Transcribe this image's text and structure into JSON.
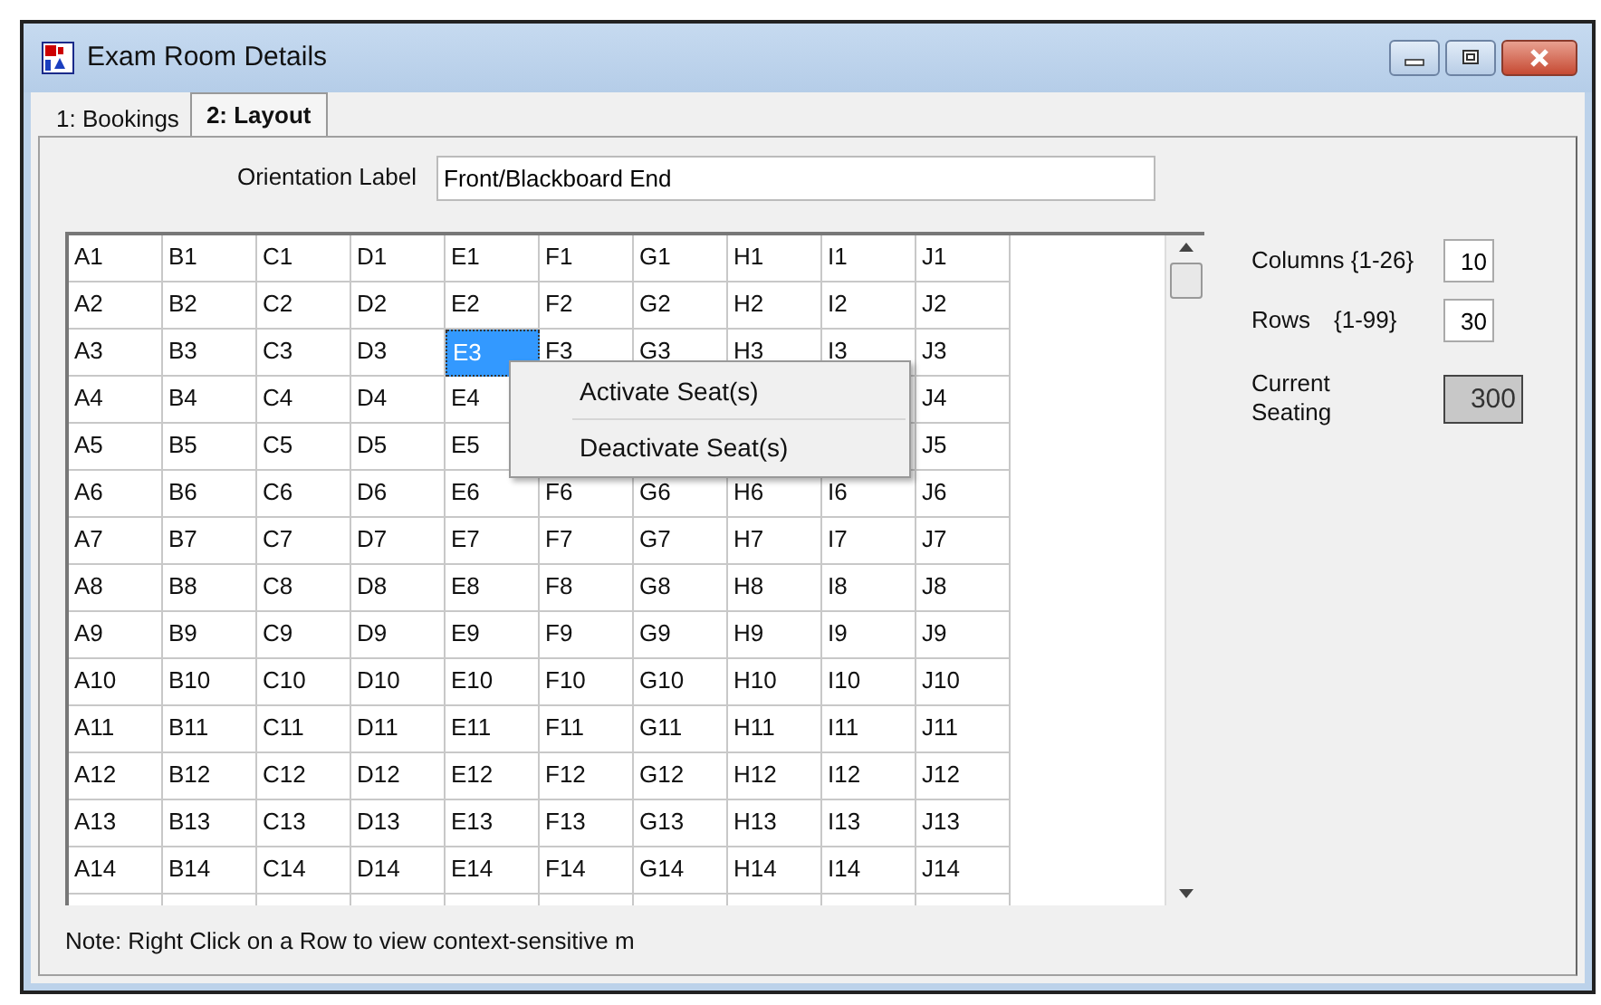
{
  "window": {
    "title": "Exam Room Details"
  },
  "tabs": [
    {
      "label": "1: Bookings",
      "selected": false
    },
    {
      "label": "2: Layout",
      "selected": true
    }
  ],
  "orientation": {
    "label": "Orientation Label",
    "value": "Front/Blackboard End"
  },
  "grid": {
    "rows": [
      [
        {
          "text": "A1",
          "selected": false
        },
        {
          "text": "B1",
          "selected": false
        },
        {
          "text": "C1",
          "selected": false
        },
        {
          "text": "D1",
          "selected": false
        },
        {
          "text": "E1",
          "selected": false
        },
        {
          "text": "F1",
          "selected": false
        },
        {
          "text": "G1",
          "selected": false
        },
        {
          "text": "H1",
          "selected": false
        },
        {
          "text": "I1",
          "selected": false
        },
        {
          "text": "J1",
          "selected": false
        }
      ],
      [
        {
          "text": "A2",
          "selected": false
        },
        {
          "text": "B2",
          "selected": false
        },
        {
          "text": "C2",
          "selected": false
        },
        {
          "text": "D2",
          "selected": false
        },
        {
          "text": "E2",
          "selected": false
        },
        {
          "text": "F2",
          "selected": false
        },
        {
          "text": "G2",
          "selected": false
        },
        {
          "text": "H2",
          "selected": false
        },
        {
          "text": "I2",
          "selected": false
        },
        {
          "text": "J2",
          "selected": false
        }
      ],
      [
        {
          "text": "A3",
          "selected": false
        },
        {
          "text": "B3",
          "selected": false
        },
        {
          "text": "C3",
          "selected": false
        },
        {
          "text": "D3",
          "selected": false
        },
        {
          "text": "E3",
          "selected": true
        },
        {
          "text": "F3",
          "selected": false
        },
        {
          "text": "G3",
          "selected": false
        },
        {
          "text": "H3",
          "selected": false
        },
        {
          "text": "I3",
          "selected": false
        },
        {
          "text": "J3",
          "selected": false
        }
      ],
      [
        {
          "text": "A4",
          "selected": false
        },
        {
          "text": "B4",
          "selected": false
        },
        {
          "text": "C4",
          "selected": false
        },
        {
          "text": "D4",
          "selected": false
        },
        {
          "text": "E4",
          "selected": false
        },
        null,
        null,
        null,
        null,
        {
          "text": "J4",
          "selected": false
        }
      ],
      [
        {
          "text": "A5",
          "selected": false
        },
        {
          "text": "B5",
          "selected": false
        },
        {
          "text": "C5",
          "selected": false
        },
        {
          "text": "D5",
          "selected": false
        },
        {
          "text": "E5",
          "selected": false
        },
        null,
        null,
        null,
        null,
        {
          "text": "J5",
          "selected": false
        }
      ],
      [
        {
          "text": "A6",
          "selected": false
        },
        {
          "text": "B6",
          "selected": false
        },
        {
          "text": "C6",
          "selected": false
        },
        {
          "text": "D6",
          "selected": false
        },
        {
          "text": "E6",
          "selected": false
        },
        {
          "text": "F6",
          "selected": false
        },
        {
          "text": "G6",
          "selected": false
        },
        {
          "text": "H6",
          "selected": false
        },
        {
          "text": "I6",
          "selected": false
        },
        {
          "text": "J6",
          "selected": false
        }
      ],
      [
        {
          "text": "A7",
          "selected": false
        },
        {
          "text": "B7",
          "selected": false
        },
        {
          "text": "C7",
          "selected": false
        },
        {
          "text": "D7",
          "selected": false
        },
        {
          "text": "E7",
          "selected": false
        },
        {
          "text": "F7",
          "selected": false
        },
        {
          "text": "G7",
          "selected": false
        },
        {
          "text": "H7",
          "selected": false
        },
        {
          "text": "I7",
          "selected": false
        },
        {
          "text": "J7",
          "selected": false
        }
      ],
      [
        {
          "text": "A8",
          "selected": false
        },
        {
          "text": "B8",
          "selected": false
        },
        {
          "text": "C8",
          "selected": false
        },
        {
          "text": "D8",
          "selected": false
        },
        {
          "text": "E8",
          "selected": false
        },
        {
          "text": "F8",
          "selected": false
        },
        {
          "text": "G8",
          "selected": false
        },
        {
          "text": "H8",
          "selected": false
        },
        {
          "text": "I8",
          "selected": false
        },
        {
          "text": "J8",
          "selected": false
        }
      ],
      [
        {
          "text": "A9",
          "selected": false
        },
        {
          "text": "B9",
          "selected": false
        },
        {
          "text": "C9",
          "selected": false
        },
        {
          "text": "D9",
          "selected": false
        },
        {
          "text": "E9",
          "selected": false
        },
        {
          "text": "F9",
          "selected": false
        },
        {
          "text": "G9",
          "selected": false
        },
        {
          "text": "H9",
          "selected": false
        },
        {
          "text": "I9",
          "selected": false
        },
        {
          "text": "J9",
          "selected": false
        }
      ],
      [
        {
          "text": "A10",
          "selected": false
        },
        {
          "text": "B10",
          "selected": false
        },
        {
          "text": "C10",
          "selected": false
        },
        {
          "text": "D10",
          "selected": false
        },
        {
          "text": "E10",
          "selected": false
        },
        {
          "text": "F10",
          "selected": false
        },
        {
          "text": "G10",
          "selected": false
        },
        {
          "text": "H10",
          "selected": false
        },
        {
          "text": "I10",
          "selected": false
        },
        {
          "text": "J10",
          "selected": false
        }
      ],
      [
        {
          "text": "A11",
          "selected": false
        },
        {
          "text": "B11",
          "selected": false
        },
        {
          "text": "C11",
          "selected": false
        },
        {
          "text": "D11",
          "selected": false
        },
        {
          "text": "E11",
          "selected": false
        },
        {
          "text": "F11",
          "selected": false
        },
        {
          "text": "G11",
          "selected": false
        },
        {
          "text": "H11",
          "selected": false
        },
        {
          "text": "I11",
          "selected": false
        },
        {
          "text": "J11",
          "selected": false
        }
      ],
      [
        {
          "text": "A12",
          "selected": false
        },
        {
          "text": "B12",
          "selected": false
        },
        {
          "text": "C12",
          "selected": false
        },
        {
          "text": "D12",
          "selected": false
        },
        {
          "text": "E12",
          "selected": false
        },
        {
          "text": "F12",
          "selected": false
        },
        {
          "text": "G12",
          "selected": false
        },
        {
          "text": "H12",
          "selected": false
        },
        {
          "text": "I12",
          "selected": false
        },
        {
          "text": "J12",
          "selected": false
        }
      ],
      [
        {
          "text": "A13",
          "selected": false
        },
        {
          "text": "B13",
          "selected": false
        },
        {
          "text": "C13",
          "selected": false
        },
        {
          "text": "D13",
          "selected": false
        },
        {
          "text": "E13",
          "selected": false
        },
        {
          "text": "F13",
          "selected": false
        },
        {
          "text": "G13",
          "selected": false
        },
        {
          "text": "H13",
          "selected": false
        },
        {
          "text": "I13",
          "selected": false
        },
        {
          "text": "J13",
          "selected": false
        }
      ],
      [
        {
          "text": "A14",
          "selected": false
        },
        {
          "text": "B14",
          "selected": false
        },
        {
          "text": "C14",
          "selected": false
        },
        {
          "text": "D14",
          "selected": false
        },
        {
          "text": "E14",
          "selected": false
        },
        {
          "text": "F14",
          "selected": false
        },
        {
          "text": "G14",
          "selected": false
        },
        {
          "text": "H14",
          "selected": false
        },
        {
          "text": "I14",
          "selected": false
        },
        {
          "text": "J14",
          "selected": false
        }
      ]
    ]
  },
  "context_menu": {
    "items": [
      {
        "label": "Activate Seat(s)"
      },
      {
        "label": "Deactivate Seat(s)"
      }
    ]
  },
  "settings": {
    "columns_label": "Columns {1-26}",
    "columns_value": "10",
    "rows_label": "Rows",
    "rows_range": "{1-99}",
    "rows_value": "30",
    "seating_label": "Current Seating",
    "seating_value": "300"
  },
  "note": "Note: Right Click on a Row to view context-sensitive m"
}
